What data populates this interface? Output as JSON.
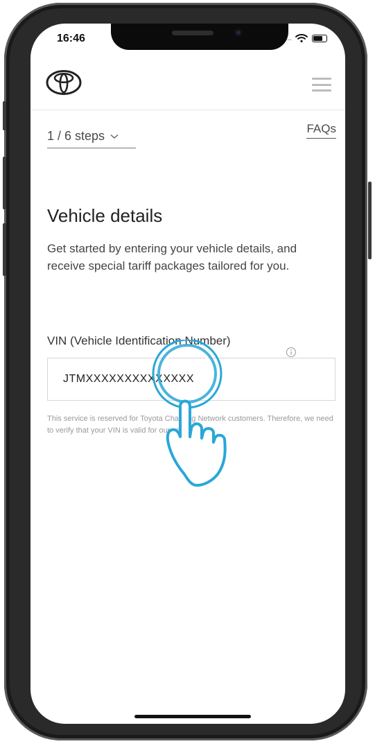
{
  "status_bar": {
    "time": "16:46",
    "signal": "...."
  },
  "header": {
    "logo": "toyota-logo",
    "menu_icon": "hamburger-icon"
  },
  "steps": {
    "label": "1 / 6 steps"
  },
  "faqs": {
    "label": "FAQs"
  },
  "page": {
    "title": "Vehicle details",
    "description": "Get started by entering your vehicle details, and receive special tariff packages tailored for you."
  },
  "vin": {
    "label": "VIN (Vehicle Identification Number)",
    "value": "JTMXXXXXXXXXXXXXX",
    "note": "This service is reserved for Toyota Charging Network customers. Therefore, we need to verify that your VIN is valid for our service."
  },
  "colors": {
    "accent_tap": "#2aa7d8",
    "text": "#444444",
    "divider": "#e6e6e6"
  }
}
